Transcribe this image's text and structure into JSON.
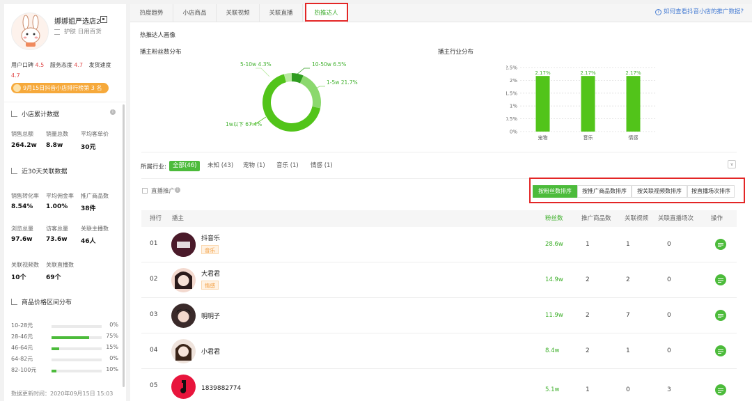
{
  "store": {
    "name": "娜娜姐严选店2",
    "category": "护肤 日用百货",
    "ratings": [
      {
        "label": "用户口碑",
        "value": "4.5"
      },
      {
        "label": "服务态度",
        "value": "4.7"
      },
      {
        "label": "发货速度",
        "value": "4.7"
      }
    ],
    "rank_badge": "9月15日抖音小店排行榜第 3 名"
  },
  "sidebar": {
    "cumulative": {
      "title": "小店累计数据",
      "stats": [
        {
          "label": "销售总额",
          "value": "264.2w"
        },
        {
          "label": "销量总数",
          "value": "8.8w"
        },
        {
          "label": "平均客单价",
          "value": "30元"
        }
      ]
    },
    "recent": {
      "title": "近30天关联数据",
      "stats": [
        {
          "label": "销售转化率",
          "value": "8.54%"
        },
        {
          "label": "平均佣金率",
          "value": "1.00%"
        },
        {
          "label": "推广商品数",
          "value": "38件"
        },
        {
          "label": "浏览总量",
          "value": "97.6w"
        },
        {
          "label": "访客总量",
          "value": "73.6w"
        },
        {
          "label": "关联主播数",
          "value": "46人"
        },
        {
          "label": "关联视频数",
          "value": "10个"
        },
        {
          "label": "关联直播数",
          "value": "69个"
        }
      ]
    },
    "price_dist": {
      "title": "商品价格区间分布",
      "rows": [
        {
          "label": "10-28元",
          "pct": "0%",
          "fill": 0
        },
        {
          "label": "28-46元",
          "pct": "75%",
          "fill": 75
        },
        {
          "label": "46-64元",
          "pct": "15%",
          "fill": 15
        },
        {
          "label": "64-82元",
          "pct": "0%",
          "fill": 0
        },
        {
          "label": "82-100元",
          "pct": "10%",
          "fill": 10
        }
      ]
    },
    "update_time": "数据更新时间：2020年09月15日 15:03"
  },
  "tabs": [
    "热度趋势",
    "小店商品",
    "关联视频",
    "关联直播",
    "热推达人"
  ],
  "active_tab": 4,
  "help_link": "如何查看抖音小店的推广数据?",
  "portrait": {
    "title": "热推达人画像",
    "fans_title": "播主粉丝数分布",
    "industry_title": "播主行业分布"
  },
  "fans_labels": [
    "5-10w 4.3%",
    "10-50w 6.5%",
    "1-5w 21.7%",
    "1w以下 67.4%"
  ],
  "chart_data": [
    {
      "type": "pie",
      "title": "播主粉丝数分布",
      "categories": [
        "1w以下",
        "1-5w",
        "5-10w",
        "10-50w"
      ],
      "values": [
        67.4,
        21.7,
        4.3,
        6.5
      ],
      "colors": [
        "#52c41a",
        "#8bd86e",
        "#b8eaa0",
        "#2f9c1f"
      ]
    },
    {
      "type": "bar",
      "title": "播主行业分布",
      "categories": [
        "宠物",
        "音乐",
        "情感"
      ],
      "values": [
        2.17,
        2.17,
        2.17
      ],
      "data_labels": [
        "2.17%",
        "2.17%",
        "2.17%"
      ],
      "ylim": [
        0,
        2.5
      ],
      "yticks": [
        "0%",
        "0.5%",
        "1%",
        "1.5%",
        "2%",
        "2.5%"
      ],
      "grid": true,
      "color": "#52c41a"
    }
  ],
  "filter": {
    "label": "所属行业:",
    "options": [
      "全部(46)",
      "未知 (43)",
      "宠物 (1)",
      "音乐 (1)",
      "情感 (1)"
    ],
    "expand": "∨"
  },
  "live_promo": "直播推广",
  "sort_buttons": [
    "按粉丝数排序",
    "按推广商品数排序",
    "按关联视频数排序",
    "按直播场次排序"
  ],
  "table": {
    "headers": [
      "排行",
      "播主",
      "粉丝数",
      "推广商品数",
      "关联视频",
      "关联直播场次",
      "操作"
    ],
    "rows": [
      {
        "rank": "01",
        "name": "抖音乐",
        "tag": "音乐",
        "fans": "28.6w",
        "goods": "1",
        "videos": "1",
        "live": "0"
      },
      {
        "rank": "02",
        "name": "大君君",
        "tag": "情感",
        "fans": "14.9w",
        "goods": "2",
        "videos": "2",
        "live": "0"
      },
      {
        "rank": "03",
        "name": "明明子",
        "tag": "",
        "fans": "11.9w",
        "goods": "2",
        "videos": "7",
        "live": "0"
      },
      {
        "rank": "04",
        "name": "小君君",
        "tag": "",
        "fans": "8.4w",
        "goods": "2",
        "videos": "1",
        "live": "0"
      },
      {
        "rank": "05",
        "name": "1839882774",
        "tag": "",
        "fans": "5.1w",
        "goods": "1",
        "videos": "0",
        "live": "3"
      }
    ]
  }
}
